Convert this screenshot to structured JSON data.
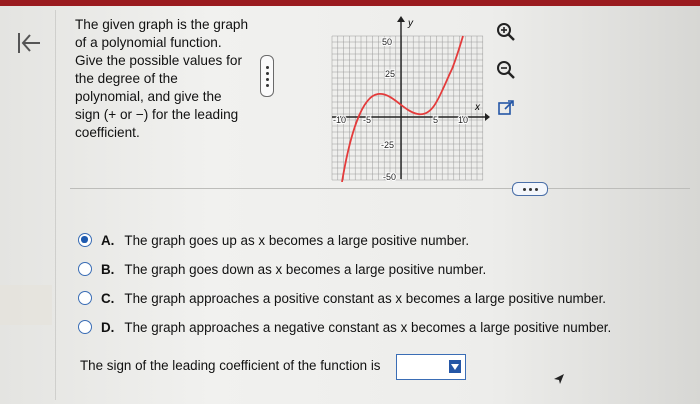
{
  "question": {
    "text": "The given graph is the graph of a polynomial function. Give the possible values for the degree of the polynomial, and give the sign (+ or −) for the leading coefficient."
  },
  "graph": {
    "y_axis_label": "y",
    "x_axis_label": "x",
    "x_tick_labels": [
      "-10",
      "-5",
      "5",
      "10"
    ],
    "y_tick_labels": [
      "50",
      "25",
      "-25",
      "-50"
    ],
    "curve_color": "#e43b3b"
  },
  "tools": [
    "zoom-in-icon",
    "zoom-out-icon",
    "external-link-icon"
  ],
  "options": [
    {
      "letter": "A.",
      "text": "The graph goes up as x becomes a large positive number.",
      "selected": true
    },
    {
      "letter": "B.",
      "text": "The graph goes down as x becomes a large positive number.",
      "selected": false
    },
    {
      "letter": "C.",
      "text": "The graph approaches a positive constant as x becomes a large positive number.",
      "selected": false
    },
    {
      "letter": "D.",
      "text": "The graph approaches a negative constant as x becomes a large positive number.",
      "selected": false
    }
  ],
  "sign_prompt": "The sign of the leading coefficient of the function is",
  "sign_select": {
    "value": ""
  },
  "colors": {
    "accent": "#1f5bb0",
    "topbar": "#9a1b1f"
  }
}
